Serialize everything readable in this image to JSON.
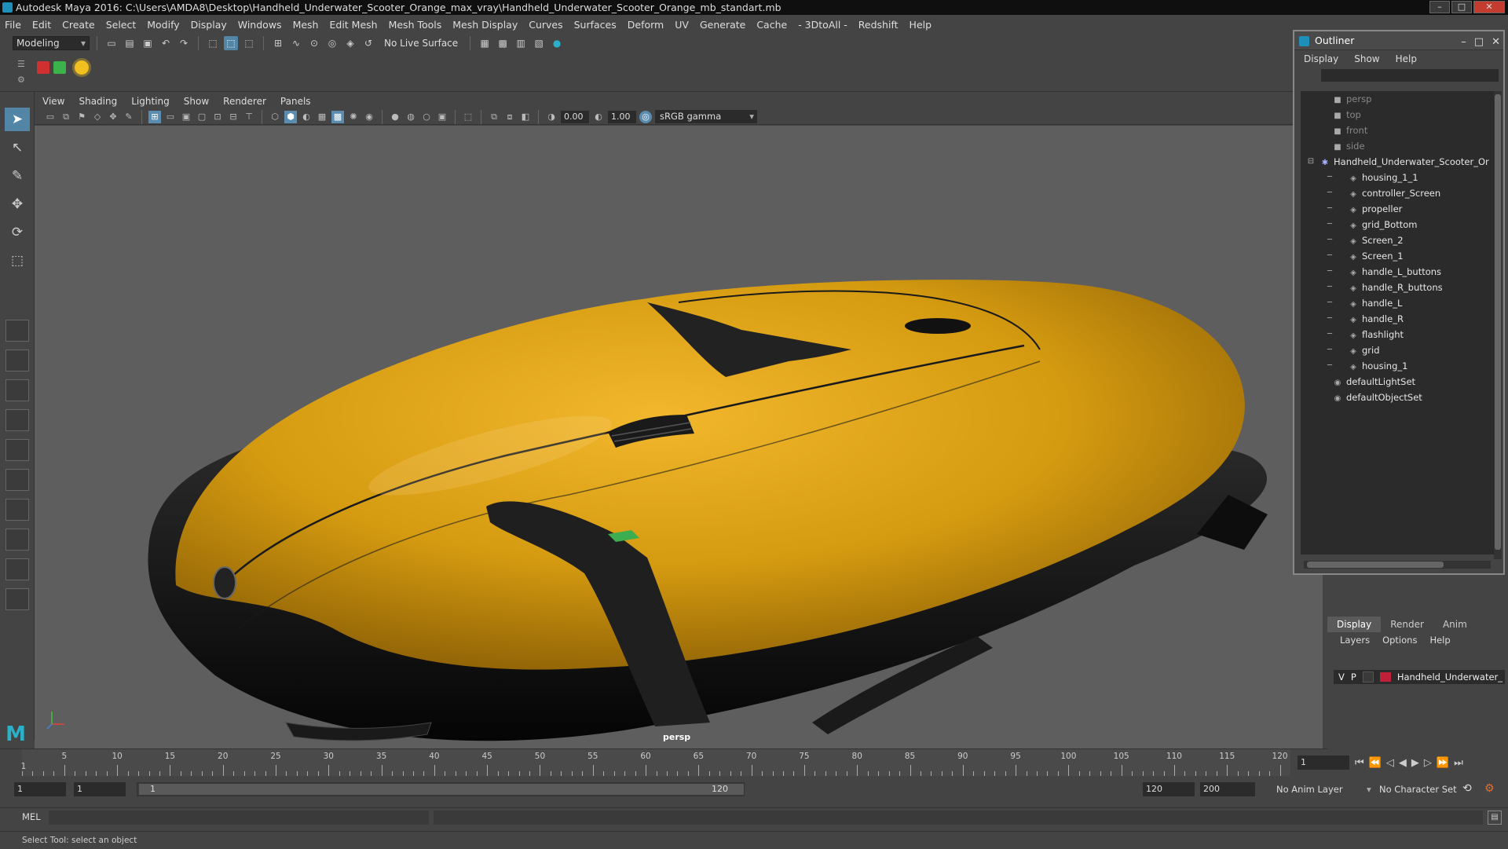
{
  "window": {
    "title": "Autodesk Maya 2016: C:\\Users\\AMDA8\\Desktop\\Handheld_Underwater_Scooter_Orange_max_vray\\Handheld_Underwater_Scooter_Orange_mb_standart.mb"
  },
  "menus": [
    "File",
    "Edit",
    "Create",
    "Select",
    "Modify",
    "Display",
    "Windows",
    "Mesh",
    "Edit Mesh",
    "Mesh Tools",
    "Mesh Display",
    "Curves",
    "Surfaces",
    "Deform",
    "UV",
    "Generate",
    "Cache",
    "- 3DtoAll -",
    "Redshift",
    "Help"
  ],
  "shelf": {
    "mode": "Modeling",
    "live_surface": "No Live Surface"
  },
  "viewport": {
    "menus": [
      "View",
      "Shading",
      "Lighting",
      "Show",
      "Renderer",
      "Panels"
    ],
    "field_a": "0.00",
    "field_b": "1.00",
    "gamma": "sRGB gamma",
    "camera_label": "persp"
  },
  "outliner": {
    "title": "Outliner",
    "menus": [
      "Display",
      "Show",
      "Help"
    ],
    "items": [
      {
        "label": "persp",
        "kind": "camera",
        "dim": true,
        "indent": 0
      },
      {
        "label": "top",
        "kind": "camera",
        "dim": true,
        "indent": 0
      },
      {
        "label": "front",
        "kind": "camera",
        "dim": true,
        "indent": 0
      },
      {
        "label": "side",
        "kind": "camera",
        "dim": true,
        "indent": 0
      },
      {
        "label": "Handheld_Underwater_Scooter_Or",
        "kind": "group",
        "dim": false,
        "indent": -1
      },
      {
        "label": "housing_1_1",
        "kind": "mesh",
        "dim": false,
        "indent": 1
      },
      {
        "label": "controller_Screen",
        "kind": "mesh",
        "dim": false,
        "indent": 1
      },
      {
        "label": "propeller",
        "kind": "mesh",
        "dim": false,
        "indent": 1
      },
      {
        "label": "grid_Bottom",
        "kind": "mesh",
        "dim": false,
        "indent": 1
      },
      {
        "label": "Screen_2",
        "kind": "mesh",
        "dim": false,
        "indent": 1
      },
      {
        "label": "Screen_1",
        "kind": "mesh",
        "dim": false,
        "indent": 1
      },
      {
        "label": "handle_L_buttons",
        "kind": "mesh",
        "dim": false,
        "indent": 1
      },
      {
        "label": "handle_R_buttons",
        "kind": "mesh",
        "dim": false,
        "indent": 1
      },
      {
        "label": "handle_L",
        "kind": "mesh",
        "dim": false,
        "indent": 1
      },
      {
        "label": "handle_R",
        "kind": "mesh",
        "dim": false,
        "indent": 1
      },
      {
        "label": "flashlight",
        "kind": "mesh",
        "dim": false,
        "indent": 1
      },
      {
        "label": "grid",
        "kind": "mesh",
        "dim": false,
        "indent": 1
      },
      {
        "label": "housing_1",
        "kind": "mesh",
        "dim": false,
        "indent": 1
      },
      {
        "label": "defaultLightSet",
        "kind": "set",
        "dim": false,
        "indent": 0
      },
      {
        "label": "defaultObjectSet",
        "kind": "set",
        "dim": false,
        "indent": 0
      }
    ]
  },
  "layers": {
    "tabs": [
      "Display",
      "Render",
      "Anim"
    ],
    "menus": [
      "Layers",
      "Options",
      "Help"
    ],
    "row": {
      "v": "V",
      "p": "P",
      "name": "Handheld_Underwater_",
      "color": "#c0203a"
    }
  },
  "timeline": {
    "ticks": [
      5,
      10,
      15,
      20,
      25,
      30,
      35,
      40,
      45,
      50,
      55,
      60,
      65,
      70,
      75,
      80,
      85,
      90,
      95,
      100,
      105,
      110,
      115,
      120
    ],
    "start_label": "1",
    "current_frame": "1"
  },
  "range": {
    "start": "1",
    "start2": "1",
    "slider_start": "1",
    "slider_end": "120",
    "end": "120",
    "end2": "200",
    "anim_layer": "No Anim Layer",
    "char_set": "No Character Set"
  },
  "cmd": {
    "label": "MEL"
  },
  "status": {
    "text": "Select Tool: select an object"
  },
  "colors": {
    "body": "#d49a10",
    "trim": "#111111",
    "viewport_bg": "#5e5e5e",
    "accent": "#5285a6"
  }
}
